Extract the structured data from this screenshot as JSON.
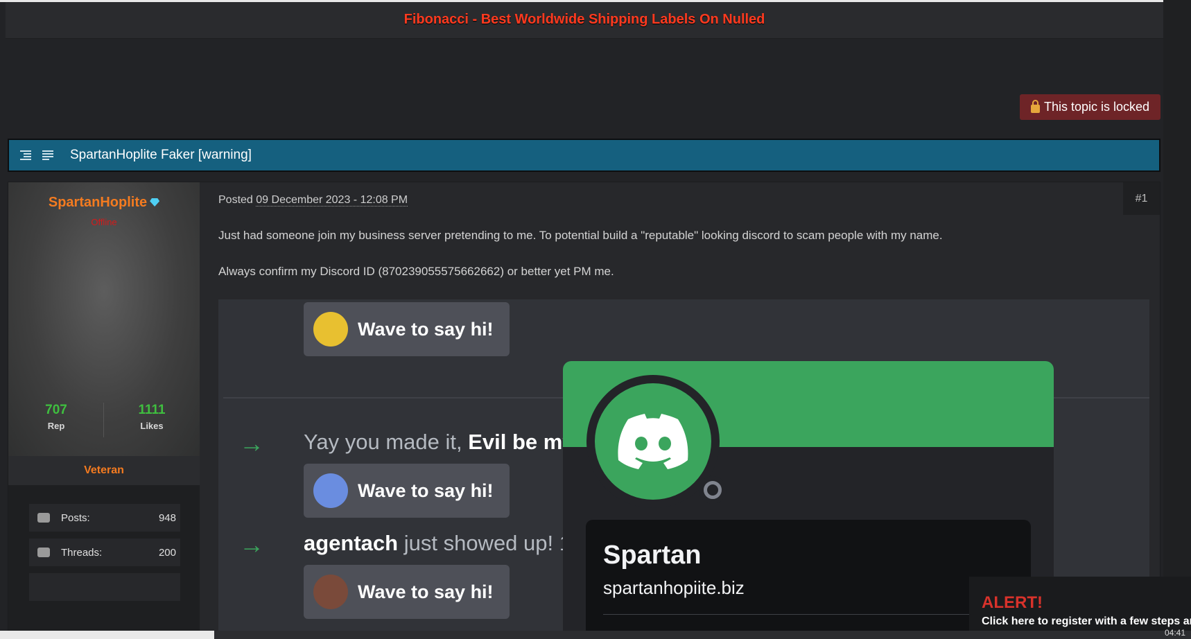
{
  "banner": {
    "text": "Fibonacci - Best Worldwide Shipping Labels On Nulled"
  },
  "locked": {
    "label": "This topic is locked",
    "icon": "lock-icon"
  },
  "topic": {
    "title": "SpartanHoplite Faker [warning]"
  },
  "author": {
    "username": "SpartanHoplite",
    "status": "Offline",
    "rep_value": "707",
    "rep_label": "Rep",
    "likes_value": "1111",
    "likes_label": "Likes",
    "rank": "Veteran",
    "stats": [
      {
        "label": "Posts:",
        "value": "948"
      },
      {
        "label": "Threads:",
        "value": "200"
      }
    ]
  },
  "post": {
    "posted_label": "Posted",
    "date": "09 December 2023 - 12:08 PM",
    "number": "#1",
    "paragraphs": [
      "Just had someone join my business server pretending to me. To potential build a \"reputable\" looking discord to scam people with my name.",
      "Always confirm my Discord ID (870239055575662662) or better yet PM me."
    ]
  },
  "screenshot": {
    "wave_label": "Wave to say hi!",
    "msg1_prefix": "Yay you made it, ",
    "msg1_bold": "Evil be my",
    "msg2_bold": "agentach",
    "msg2_rest": " just showed up! 1",
    "profile_name": "Spartan",
    "profile_handle": "spartanhopiite.biz"
  },
  "alert": {
    "title": "ALERT!",
    "text": "Click here to register with a few steps and"
  },
  "taskbar": {
    "clock": "04:41"
  },
  "colors": {
    "accent": "#15607f",
    "alert": "#d8322b",
    "discord_green": "#3ba55d",
    "banner_red": "#ff3a1f"
  }
}
